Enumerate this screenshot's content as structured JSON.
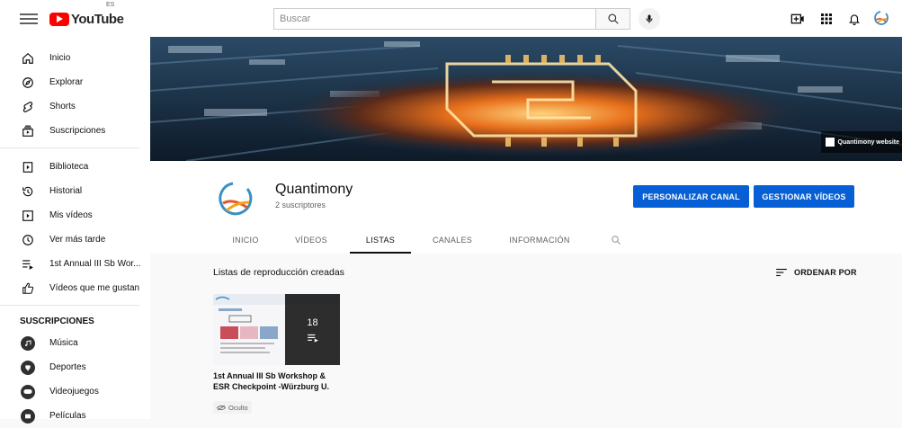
{
  "header": {
    "logo_text": "YouTube",
    "country_code": "ES",
    "search_placeholder": "Buscar"
  },
  "sidebar": {
    "main_items": [
      {
        "label": "Inicio",
        "icon": "home-icon"
      },
      {
        "label": "Explorar",
        "icon": "compass-icon"
      },
      {
        "label": "Shorts",
        "icon": "shorts-icon"
      },
      {
        "label": "Suscripciones",
        "icon": "subscriptions-icon"
      }
    ],
    "library_items": [
      {
        "label": "Biblioteca",
        "icon": "library-icon"
      },
      {
        "label": "Historial",
        "icon": "history-icon"
      },
      {
        "label": "Mis vídeos",
        "icon": "my-videos-icon"
      },
      {
        "label": "Ver más tarde",
        "icon": "watch-later-icon"
      },
      {
        "label": "1st Annual III Sb Wor...",
        "icon": "playlist-icon"
      },
      {
        "label": "Vídeos que me gustan",
        "icon": "thumbs-up-icon"
      }
    ],
    "subscriptions_heading": "SUSCRIPCIONES",
    "subscriptions": [
      {
        "label": "Música",
        "icon": "music-icon"
      },
      {
        "label": "Deportes",
        "icon": "sports-icon"
      },
      {
        "label": "Videojuegos",
        "icon": "gaming-icon"
      },
      {
        "label": "Películas",
        "icon": "movies-icon"
      }
    ]
  },
  "banner": {
    "link_text": "Quantimony website"
  },
  "channel": {
    "name": "Quantimony",
    "subscribers": "2 suscriptores",
    "customize_button": "PERSONALIZAR CANAL",
    "manage_button": "GESTIONAR VÍDEOS"
  },
  "tabs": [
    {
      "label": "INICIO",
      "active": false
    },
    {
      "label": "VÍDEOS",
      "active": false
    },
    {
      "label": "LISTAS",
      "active": true
    },
    {
      "label": "CANALES",
      "active": false
    },
    {
      "label": "INFORMACIÓN",
      "active": false
    }
  ],
  "content": {
    "section_title": "Listas de reproducción creadas",
    "sort_label": "ORDENAR POR",
    "playlists": [
      {
        "title": "1st Annual III Sb Workshop & ESR Checkpoint -Würzburg U.",
        "video_count": "18",
        "visibility": "Oculto"
      }
    ]
  },
  "colors": {
    "accent_blue": "#065fd4",
    "youtube_red": "#ff0000"
  }
}
